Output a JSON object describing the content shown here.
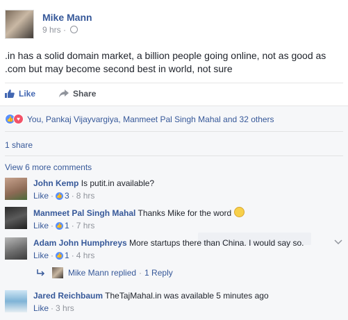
{
  "post": {
    "author": "Mike Mann",
    "time": "9 hrs",
    "separator": "·",
    "text": ".in has a solid domain market, a billion people going online, not as good as .com but may become second best in world, not sure",
    "like_label": "Like",
    "share_label": "Share"
  },
  "reactions": {
    "summary": "You, Pankaj Vijayvargiya, Manmeet Pal Singh Mahal and 32 others"
  },
  "shares": "1 share",
  "view_more": "View 6 more comments",
  "comments": [
    {
      "name": "John Kemp",
      "text": "Is putit.in available?",
      "like": "Like",
      "count": "3",
      "time": "8 hrs"
    },
    {
      "name": "Manmeet Pal Singh Mahal",
      "text": "Thanks Mike for the word",
      "like": "Like",
      "count": "1",
      "time": "7 hrs"
    },
    {
      "name": "Adam John Humphreys",
      "text": "More startups there than China. I would say so.",
      "like": "Like",
      "count": "1",
      "time": "4 hrs"
    },
    {
      "name": "Jared Reichbaum",
      "text": "TheTajMahal.in was available 5 minutes ago",
      "like": "Like",
      "time": "3 hrs"
    }
  ],
  "reply": {
    "text": "Mike Mann replied",
    "sep": "·",
    "count": "1 Reply"
  },
  "dot": "·"
}
